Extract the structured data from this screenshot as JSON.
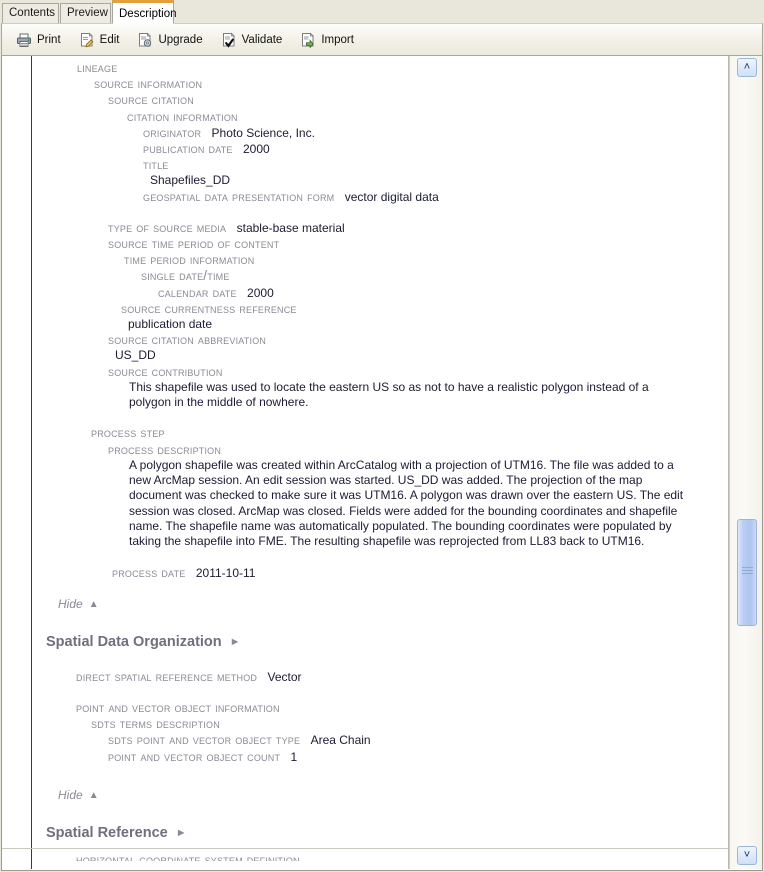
{
  "window": {
    "tabs": [
      {
        "label": "Contents",
        "active": false
      },
      {
        "label": "Preview",
        "active": false
      },
      {
        "label": "Description",
        "active": true
      }
    ]
  },
  "toolbar": {
    "buttons": [
      {
        "label": "Print",
        "icon": "printer-icon"
      },
      {
        "label": "Edit",
        "icon": "edit-document-icon"
      },
      {
        "label": "Upgrade",
        "icon": "upgrade-document-icon"
      },
      {
        "label": "Validate",
        "icon": "validate-check-icon"
      },
      {
        "label": "Import",
        "icon": "import-document-icon"
      }
    ]
  },
  "colors": {
    "accent_tab": "#e3a13c",
    "label_gray": "#8a8a96",
    "value_ink": "#1b1b33",
    "section_gray": "#6f6f7d",
    "scroll_thumb": "#aec5f0"
  },
  "metadata": {
    "lineage": {
      "heading": "Lineage",
      "source_information": "Source Information",
      "source_citation": "Source Citation",
      "citation_information": "Citation Information",
      "originator": {
        "label": "Originator",
        "value": "Photo Science, Inc."
      },
      "publication_date": {
        "label": "Publication Date",
        "value": "2000"
      },
      "title": {
        "label": "Title",
        "value": "Shapefiles_DD"
      },
      "geospatial_form": {
        "label": "Geospatial Data Presentation Form",
        "value": "vector digital data"
      },
      "type_of_source_media": {
        "label": "Type of Source Media",
        "value": "stable-base material"
      },
      "source_time_period": "Source Time Period of Content",
      "time_period_information": "Time Period Information",
      "single_date_time": "Single Date/Time",
      "calendar_date": {
        "label": "Calendar Date",
        "value": "2000"
      },
      "source_currentness": {
        "label": "Source Currentness Reference",
        "value": "publication date"
      },
      "source_citation_abbrev": {
        "label": "Source Citation Abbreviation",
        "value": "US_DD"
      },
      "source_contribution": {
        "label": "Source Contribution",
        "value": "This shapefile was used to locate the eastern US so as not to have a realistic polygon instead of a polygon in the middle of nowhere."
      },
      "process_step": "Process Step",
      "process_description": {
        "label": "Process Description",
        "value": "A polygon shapefile was created within ArcCatalog with a projection of UTM16.  The file was added to a new ArcMap session.  An edit session was started.  US_DD was added.  The projection of the map document was checked to make sure it was UTM16.  A polygon was drawn over the eastern US.  The edit session was closed.  ArcMap was closed.  Fields were added for the bounding coordinates and shapefile name.  The shapefile name was automatically populated.  The bounding coordinates were populated by taking the shapefile into FME.  The resulting shapefile was reprojected from LL83 back to UTM16."
      },
      "process_date": {
        "label": "Process Date",
        "value": "2011-10-11"
      },
      "hide_label": "Hide",
      "hide_arrow": "▲"
    },
    "spatial_data_organization": {
      "heading": "Spatial Data Organization",
      "expand_arrow": "►",
      "direct_spatial_reference_method": {
        "label": "Direct Spatial Reference Method",
        "value": "Vector"
      },
      "point_and_vector_object_information": "Point and Vector Object Information",
      "sdts_terms_description": "SDTS Terms Description",
      "sdts_point_and_vector_object_type": {
        "label": "SDTS Point and Vector Object Type",
        "value": "Area Chain"
      },
      "point_and_vector_object_count": {
        "label": "Point and Vector Object Count",
        "value": "1"
      },
      "hide_label": "Hide",
      "hide_arrow": "▲"
    },
    "spatial_reference": {
      "heading": "Spatial Reference",
      "expand_arrow": "►",
      "horizontal_coordinate_system_definition": "Horizontal Coordinate System Definition"
    }
  },
  "scrollbar": {
    "up_arrow": "˄",
    "down_arrow": "˅"
  }
}
